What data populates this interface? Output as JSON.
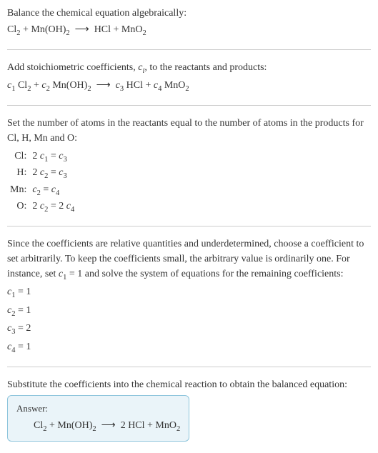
{
  "s1": {
    "title": "Balance the chemical equation algebraically:",
    "eq_html": "Cl<sub>2</sub> + Mn(OH)<sub>2</sub> &nbsp;⟶&nbsp; HCl + MnO<sub>2</sub>"
  },
  "s2": {
    "title_html": "Add stoichiometric coefficients, <span class=\"italic\">c<sub>i</sub></span>, to the reactants and products:",
    "eq_html": "<span class=\"italic\">c</span><sub>1</sub> Cl<sub>2</sub> + <span class=\"italic\">c</span><sub>2</sub> Mn(OH)<sub>2</sub> &nbsp;⟶&nbsp; <span class=\"italic\">c</span><sub>3</sub> HCl + <span class=\"italic\">c</span><sub>4</sub> MnO<sub>2</sub>"
  },
  "s3": {
    "title": "Set the number of atoms in the reactants equal to the number of atoms in the products for Cl, H, Mn and O:",
    "rows": [
      {
        "el": "Cl:",
        "eq_html": "2 <span class=\"italic\">c</span><sub>1</sub> = <span class=\"italic\">c</span><sub>3</sub>"
      },
      {
        "el": "H:",
        "eq_html": "2 <span class=\"italic\">c</span><sub>2</sub> = <span class=\"italic\">c</span><sub>3</sub>"
      },
      {
        "el": "Mn:",
        "eq_html": "<span class=\"italic\">c</span><sub>2</sub> = <span class=\"italic\">c</span><sub>4</sub>"
      },
      {
        "el": "O:",
        "eq_html": "2 <span class=\"italic\">c</span><sub>2</sub> = 2 <span class=\"italic\">c</span><sub>4</sub>"
      }
    ]
  },
  "s4": {
    "title_html": "Since the coefficients are relative quantities and underdetermined, choose a coefficient to set arbitrarily. To keep the coefficients small, the arbitrary value is ordinarily one. For instance, set <span class=\"italic\">c</span><sub>1</sub> = 1 and solve the system of equations for the remaining coefficients:",
    "coeffs": [
      "<span class=\"italic\">c</span><sub>1</sub> = 1",
      "<span class=\"italic\">c</span><sub>2</sub> = 1",
      "<span class=\"italic\">c</span><sub>3</sub> = 2",
      "<span class=\"italic\">c</span><sub>4</sub> = 1"
    ]
  },
  "s5": {
    "title": "Substitute the coefficients into the chemical reaction to obtain the balanced equation:"
  },
  "answer": {
    "label": "Answer:",
    "eq_html": "Cl<sub>2</sub> + Mn(OH)<sub>2</sub> &nbsp;⟶&nbsp; 2 HCl + MnO<sub>2</sub>"
  }
}
